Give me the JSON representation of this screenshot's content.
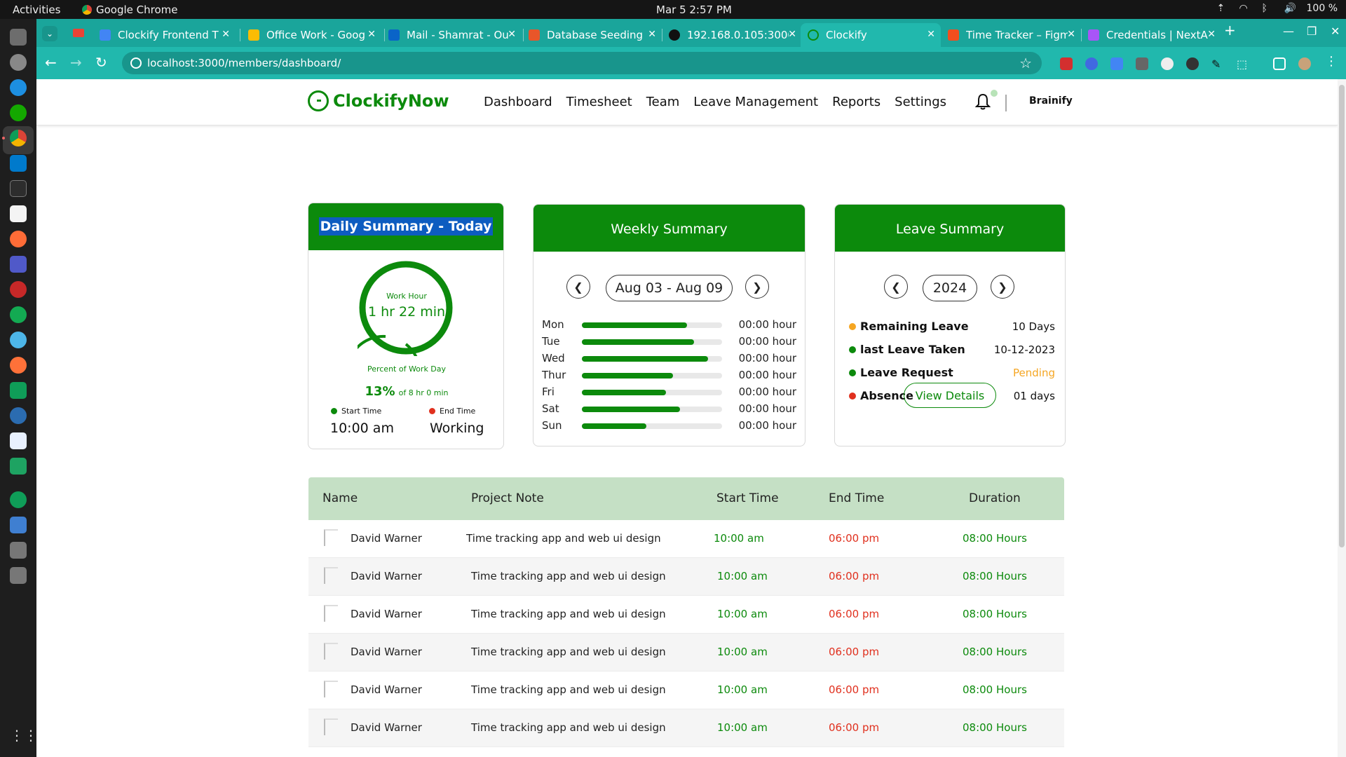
{
  "system": {
    "activities": "Activities",
    "app_name": "Google Chrome",
    "clock": "Mar 5   2:57 PM",
    "battery": "100 %"
  },
  "browser": {
    "tabs": [
      {
        "label": "Clockify Frontend T",
        "color": "#4285f4"
      },
      {
        "label": "Office Work - Goog",
        "color": "#fbbc04"
      },
      {
        "label": "Mail - Shamrat - Ou",
        "color": "#0a64c8"
      },
      {
        "label": "Database Seeding",
        "color": "#e8562a"
      },
      {
        "label": "192.168.0.105:3000",
        "color": "#111111"
      },
      {
        "label": "Clockify",
        "color": "#1aa59b"
      },
      {
        "label": "Time Tracker – Figm",
        "color": "#f24e1e"
      },
      {
        "label": "Credentials | NextA",
        "color": "#a855f7"
      }
    ],
    "url": "localhost:3000/members/dashboard/"
  },
  "app": {
    "logo": "ClockifyNow",
    "nav": [
      "Dashboard",
      "Timesheet",
      "Team",
      "Leave Management",
      "Reports",
      "Settings"
    ],
    "user": "Brainify",
    "brand_color": "#0c8a0c"
  },
  "daily": {
    "title": "Daily Summary - Today",
    "work_hour_label": "Work Hour",
    "work_hour_value": "1 hr 22 min",
    "percent_label": "Percent of Work Day",
    "percent_value": "13%",
    "percent_of": "of 8 hr 0 min",
    "start_label": "Start Time",
    "start_value": "10:00 am",
    "end_label": "End Time",
    "end_value": "Working"
  },
  "weekly": {
    "title": "Weekly Summary",
    "range": "Aug 03 - Aug 09",
    "days": [
      {
        "day": "Mon",
        "hours": "00:00 hour",
        "level": 0.75
      },
      {
        "day": "Tue",
        "hours": "00:00 hour",
        "level": 0.8
      },
      {
        "day": "Wed",
        "hours": "00:00 hour",
        "level": 0.9
      },
      {
        "day": "Thur",
        "hours": "00:00 hour",
        "level": 0.65
      },
      {
        "day": "Fri",
        "hours": "00:00 hour",
        "level": 0.6
      },
      {
        "day": "Sat",
        "hours": "00:00 hour",
        "level": 0.7
      },
      {
        "day": "Sun",
        "hours": "00:00 hour",
        "level": 0.46
      }
    ]
  },
  "leave": {
    "title": "Leave Summary",
    "year": "2024",
    "rows": [
      {
        "label": "Remaining Leave",
        "value": "10 Days",
        "dot": "#f5a623"
      },
      {
        "label": "last Leave Taken",
        "value": "10-12-2023",
        "dot": "#0c8a0c"
      },
      {
        "label": "Leave Request",
        "value": "Pending",
        "dot": "#0c8a0c"
      },
      {
        "label": "Absence",
        "value": "01 days",
        "dot": "#e0301e"
      }
    ],
    "button": "View Details"
  },
  "table": {
    "headers": [
      "Name",
      "Project Note",
      "Start Time",
      "End Time",
      "Duration"
    ],
    "rows": [
      [
        "David Warner",
        "Time tracking app and web ui design",
        "10:00 am",
        "06:00 pm",
        "08:00 Hours"
      ],
      [
        "David Warner",
        "Time tracking app and web ui design",
        "10:00 am",
        "06:00 pm",
        "08:00 Hours"
      ],
      [
        "David Warner",
        "Time tracking app and web ui design",
        "10:00 am",
        "06:00 pm",
        "08:00 Hours"
      ],
      [
        "David Warner",
        "Time tracking app and web ui design",
        "10:00 am",
        "06:00 pm",
        "08:00 Hours"
      ],
      [
        "David Warner",
        "Time tracking app and web ui design",
        "10:00 am",
        "06:00 pm",
        "08:00 Hours"
      ],
      [
        "David Warner",
        "Time tracking app and web ui design",
        "10:00 am",
        "06:00 pm",
        "08:00 Hours"
      ]
    ]
  }
}
